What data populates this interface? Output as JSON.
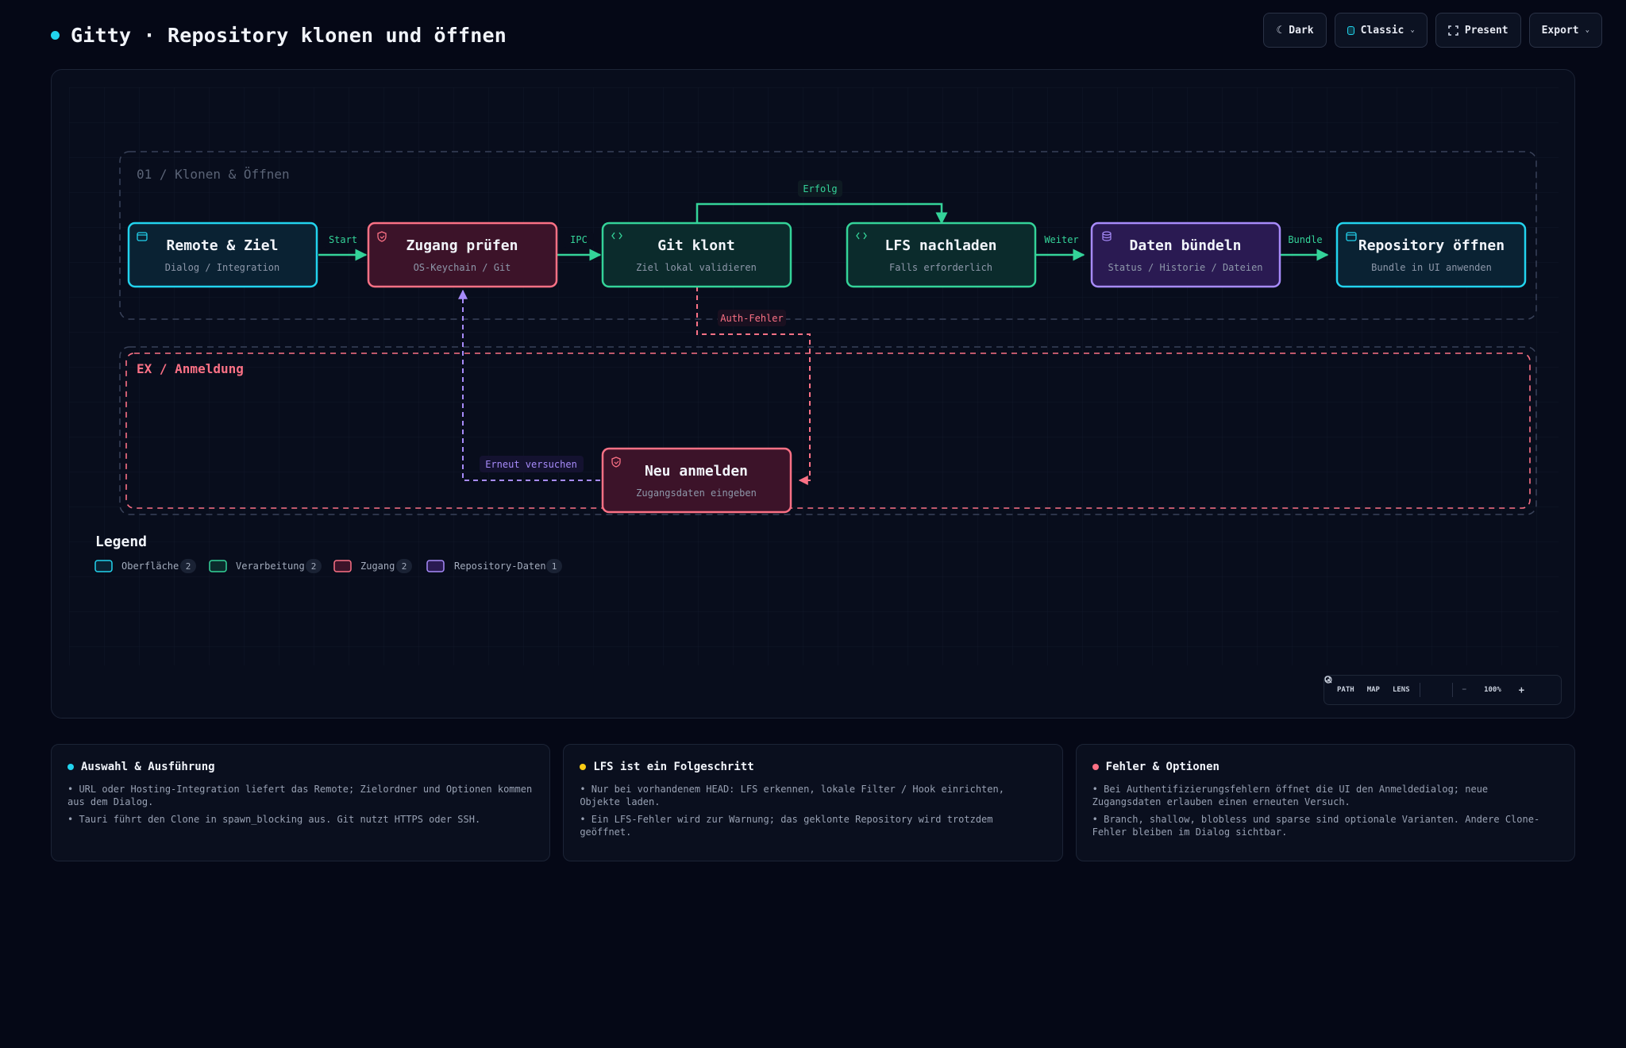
{
  "header": {
    "title": "Gitty · Repository klonen und öffnen",
    "dot_color": "#22d3ee"
  },
  "toolbar": {
    "theme_label": "Dark",
    "style_label": "Classic",
    "present_label": "Present",
    "export_label": "Export"
  },
  "diagram": {
    "groups": {
      "main": "01 / Klonen & Öffnen",
      "error": "EX / Anmeldung"
    },
    "nodes": {
      "remote": {
        "title": "Remote & Ziel",
        "subtitle": "Dialog / Integration",
        "category": "surface"
      },
      "access": {
        "title": "Zugang prüfen",
        "subtitle": "OS-Keychain / Git",
        "category": "access"
      },
      "clone": {
        "title": "Git klont",
        "subtitle": "Ziel lokal validieren",
        "category": "processing"
      },
      "lfs": {
        "title": "LFS nachladen",
        "subtitle": "Falls erforderlich",
        "category": "processing"
      },
      "bundle": {
        "title": "Daten bündeln",
        "subtitle": "Status / Historie / Dateien",
        "category": "repo-data"
      },
      "open": {
        "title": "Repository öffnen",
        "subtitle": "Bundle in UI anwenden",
        "category": "surface"
      },
      "relogin": {
        "title": "Neu anmelden",
        "subtitle": "Zugangsdaten eingeben",
        "category": "access"
      }
    },
    "edges": {
      "start": "Start",
      "ipc": "IPC",
      "success": "Erfolg",
      "next": "Weiter",
      "bundle": "Bundle",
      "auth_error": "Auth-Fehler",
      "retry": "Erneut versuchen"
    },
    "colors": {
      "surface": "#22d3ee",
      "processing": "#34d399",
      "access": "#fb7185",
      "repo_data": "#a78bfa"
    }
  },
  "legend": {
    "title": "Legend",
    "items": [
      {
        "label": "Oberfläche",
        "count": "2"
      },
      {
        "label": "Verarbeitung",
        "count": "2"
      },
      {
        "label": "Zugang",
        "count": "2"
      },
      {
        "label": "Repository-Daten",
        "count": "1"
      }
    ]
  },
  "zoombar": {
    "path": "PATH",
    "map": "MAP",
    "lens": "LENS",
    "zoom_out": "−",
    "zoom": "100%",
    "zoom_in": "+"
  },
  "cards": [
    {
      "title": "Auswahl & Ausführung",
      "color": "#22d3ee",
      "items": [
        "• URL oder Hosting-Integration liefert das Remote; Zielordner und Optionen kommen aus dem Dialog.",
        "• Tauri führt den Clone in spawn_blocking aus. Git nutzt HTTPS oder SSH."
      ]
    },
    {
      "title": "LFS ist ein Folgeschritt",
      "color": "#facc15",
      "items": [
        "• Nur bei vorhandenem HEAD: LFS erkennen, lokale Filter / Hook einrichten, Objekte laden.",
        "• Ein LFS-Fehler wird zur Warnung; das geklonte Repository wird trotzdem geöffnet."
      ]
    },
    {
      "title": "Fehler & Optionen",
      "color": "#fb7185",
      "items": [
        "• Bei Authentifizierungsfehlern öffnet die UI den Anmeldedialog; neue Zugangsdaten erlauben einen erneuten Versuch.",
        "• Branch, shallow, blobless und sparse sind optionale Varianten. Andere Clone-Fehler bleiben im Dialog sichtbar."
      ]
    }
  ]
}
